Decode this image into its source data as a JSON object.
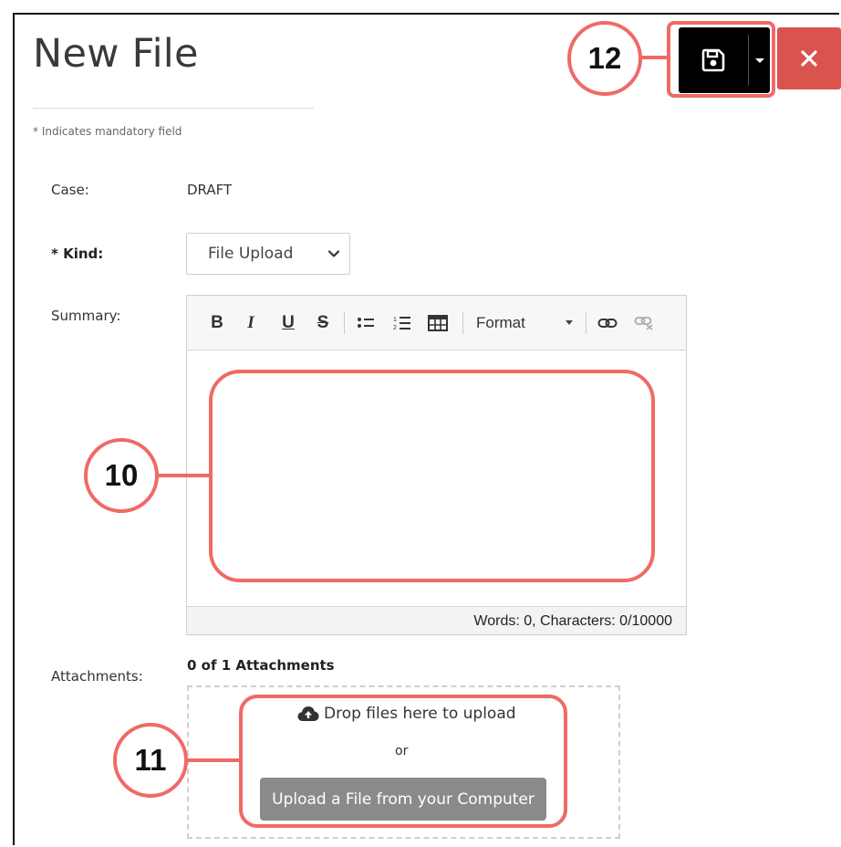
{
  "page": {
    "title": "New File",
    "mandatory_note": "* Indicates mandatory field"
  },
  "header_actions": {
    "save_icon": "floppy-disk-icon",
    "dropdown_icon": "caret-down-icon",
    "close_icon": "x-icon"
  },
  "form": {
    "case": {
      "label": "Case:",
      "value": "DRAFT"
    },
    "kind": {
      "label": "* Kind:",
      "selected": "File Upload"
    },
    "summary": {
      "label": "Summary:",
      "toolbar": {
        "bold": "B",
        "italic": "I",
        "underline": "U",
        "strikethrough": "S",
        "format": "Format"
      },
      "footer": "Words: 0, Characters: 0/10000"
    },
    "attachments": {
      "label": "Attachments:",
      "count": "0 of 1 Attachments",
      "drop_text": "Drop files here to upload",
      "or_text": "or",
      "upload_button": "Upload a File from your Computer"
    }
  },
  "annotations": {
    "editor_marker": "10",
    "upload_marker": "11",
    "save_marker": "12"
  },
  "colors": {
    "annotation": "#ef6a66",
    "close_button": "#d9534f",
    "upload_button": "#8a8a8a",
    "save_button": "#000000"
  }
}
